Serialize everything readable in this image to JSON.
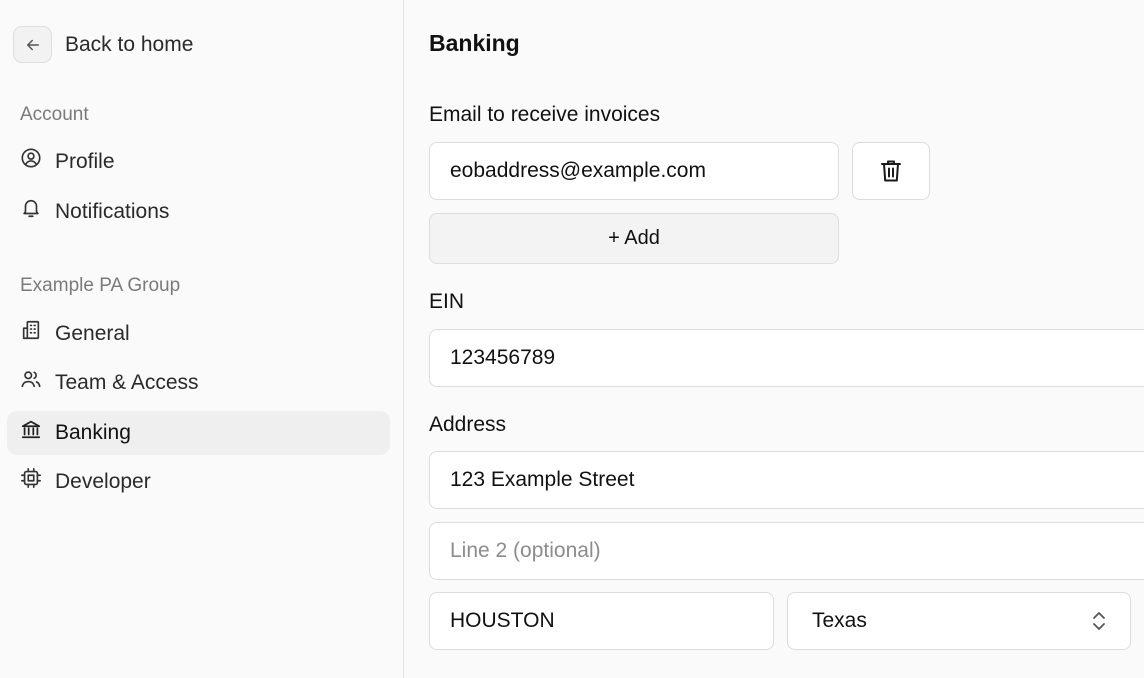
{
  "sidebar": {
    "back_label": "Back to home",
    "account_section": "Account",
    "account_items": [
      {
        "label": "Profile",
        "icon": "user-circle-icon"
      },
      {
        "label": "Notifications",
        "icon": "bell-icon"
      }
    ],
    "group_section": "Example PA Group",
    "group_items": [
      {
        "label": "General",
        "icon": "building-icon"
      },
      {
        "label": "Team & Access",
        "icon": "users-icon"
      },
      {
        "label": "Banking",
        "icon": "bank-icon",
        "active": true
      },
      {
        "label": "Developer",
        "icon": "chip-icon"
      }
    ]
  },
  "main": {
    "title": "Banking",
    "email": {
      "label": "Email to receive invoices",
      "value": "eobaddress@example.com",
      "add_label": "+ Add"
    },
    "ein": {
      "label": "EIN",
      "value": "123456789"
    },
    "address": {
      "label": "Address",
      "line1": "123 Example Street",
      "line2_placeholder": "Line 2 (optional)",
      "city": "HOUSTON",
      "state": "Texas"
    }
  },
  "colors": {
    "background": "#fafafa",
    "active_item": "#efefef",
    "border": "#dcdcdc",
    "muted_text": "#7a7a7a"
  }
}
